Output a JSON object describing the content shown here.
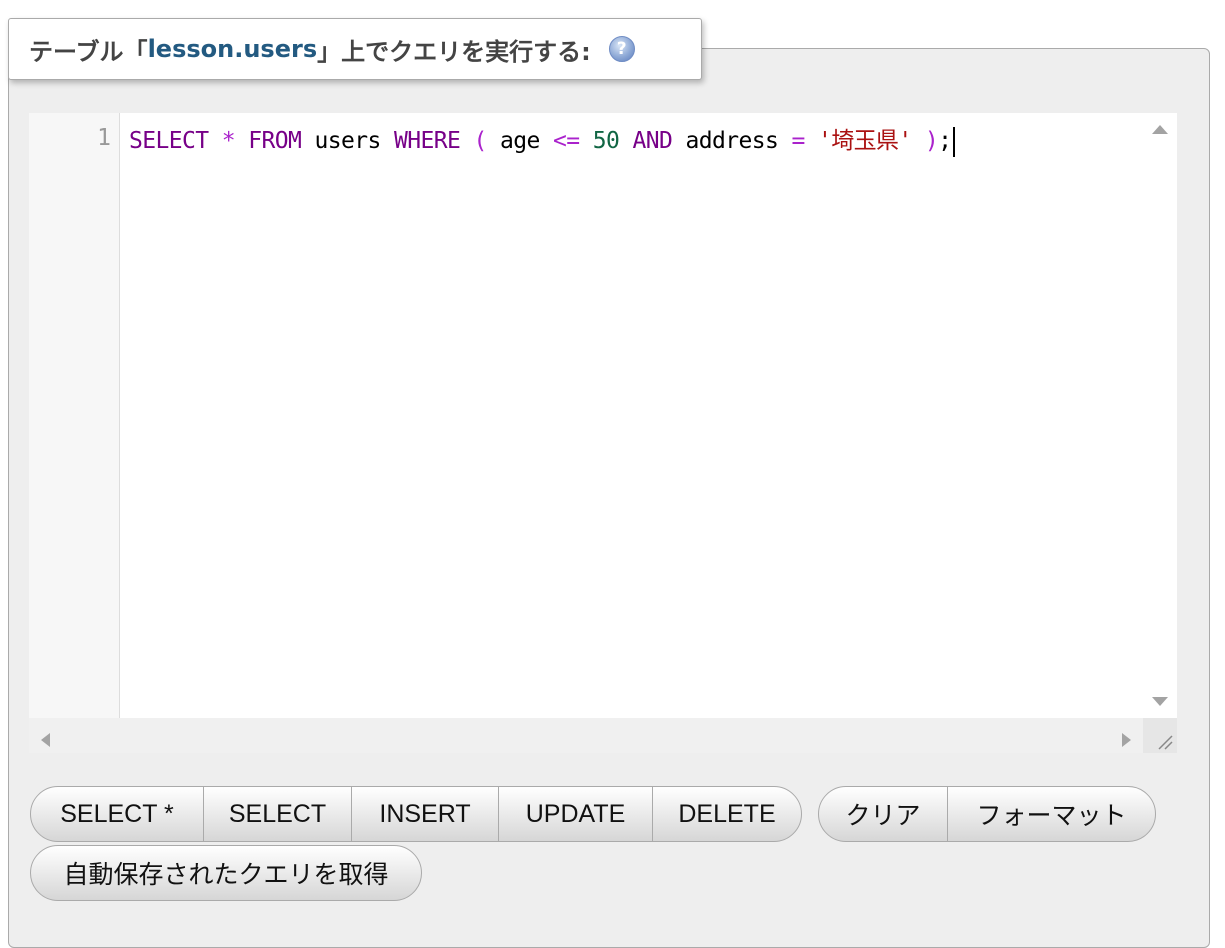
{
  "legend": {
    "prefix": "テーブル「",
    "table_name": "lesson.users",
    "suffix": "」上でクエリを実行する:",
    "help_glyph": "?"
  },
  "editor": {
    "line_number": "1",
    "tokens": {
      "t1": "SELECT",
      "t2": " ",
      "t3": "*",
      "t4": " ",
      "t5": "FROM",
      "t6": " users ",
      "t7": "WHERE",
      "t8": " ",
      "t9": "(",
      "t10": " age ",
      "t11": "<=",
      "t12": " ",
      "t13": "50",
      "t14": " ",
      "t15": "AND",
      "t16": " address ",
      "t17": "=",
      "t18": " ",
      "t19": "'埼玉県'",
      "t20": " ",
      "t21": ")",
      "t22": ";"
    }
  },
  "buttons": {
    "select_all": "SELECT *",
    "select": "SELECT",
    "insert": "INSERT",
    "update": "UPDATE",
    "delete": "DELETE",
    "clear": "クリア",
    "format": "フォーマット",
    "get_autosaved": "自動保存されたクエリを取得"
  },
  "colors": {
    "keyword": "#770088",
    "operator": "#aa22cc",
    "number": "#116644",
    "string": "#aa1111",
    "table_name": "#235a81"
  },
  "icons": {
    "help": "help-icon",
    "scroll_up": "arrow-up-icon",
    "scroll_down": "arrow-down-icon",
    "scroll_left": "arrow-left-icon",
    "scroll_right": "arrow-right-icon",
    "resize": "resize-grip-icon"
  }
}
